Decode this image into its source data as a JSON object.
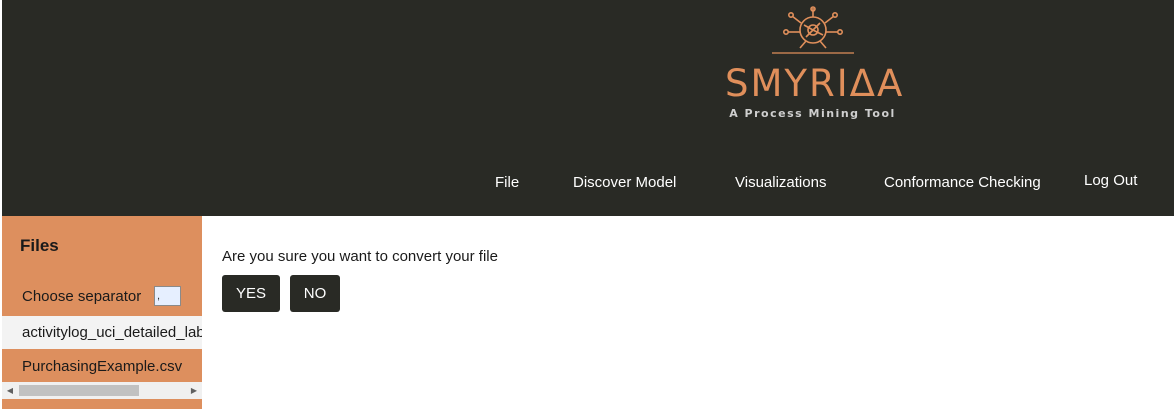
{
  "logo": {
    "name": "SMYRIΔA",
    "tagline": "A Process Mining Tool",
    "icon": "process-network-logo-icon",
    "accent_color": "#e08f5b"
  },
  "nav": {
    "items": [
      {
        "label": "File"
      },
      {
        "label": "Discover Model"
      },
      {
        "label": "Visualizations"
      },
      {
        "label": "Conformance Checking"
      },
      {
        "label": "Log Out"
      }
    ]
  },
  "sidebar": {
    "title": "Files",
    "separator_label": "Choose separator",
    "separator_value": ",",
    "files": [
      {
        "name": "activitylog_uci_detailed_labour.csv"
      },
      {
        "name": "PurchasingExample.csv"
      }
    ]
  },
  "dialog": {
    "message": "Are you sure you want to convert your file",
    "yes_label": "YES",
    "no_label": "NO"
  },
  "colors": {
    "header_bg": "#292a25",
    "sidebar_bg": "#dd8f5e",
    "button_bg": "#292a25"
  }
}
